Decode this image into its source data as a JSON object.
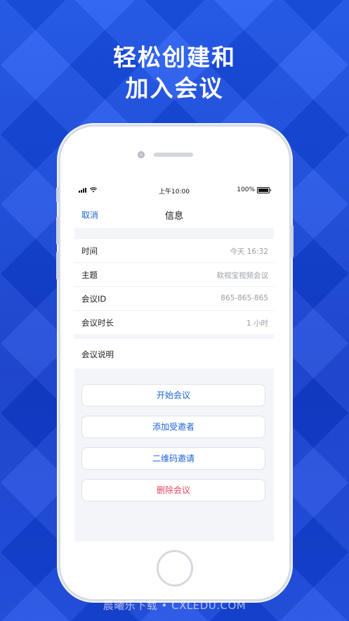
{
  "promo": {
    "headline_line1": "轻松创建和",
    "headline_line2": "加入会议"
  },
  "status_bar": {
    "time": "上午10:00",
    "battery": "100%"
  },
  "nav": {
    "cancel_label": "取消",
    "title": "信息"
  },
  "details": [
    {
      "label": "时间",
      "value": "今天 16:32"
    },
    {
      "label": "主题",
      "value": "软视宝视频会议"
    },
    {
      "label": "会议ID",
      "value": "865-865-865"
    },
    {
      "label": "会议时长",
      "value": "1 小时"
    }
  ],
  "description": {
    "label": "会议说明"
  },
  "actions": {
    "start": "开始会议",
    "add_invitee": "添加受邀者",
    "qr_invite": "二维码邀请",
    "delete": "删除会议"
  },
  "colors": {
    "background": "#1546e0",
    "accent": "#1d63d8",
    "danger": "#e8455f"
  },
  "watermark": "晨曦乐下载 • CXLEDU.COM"
}
